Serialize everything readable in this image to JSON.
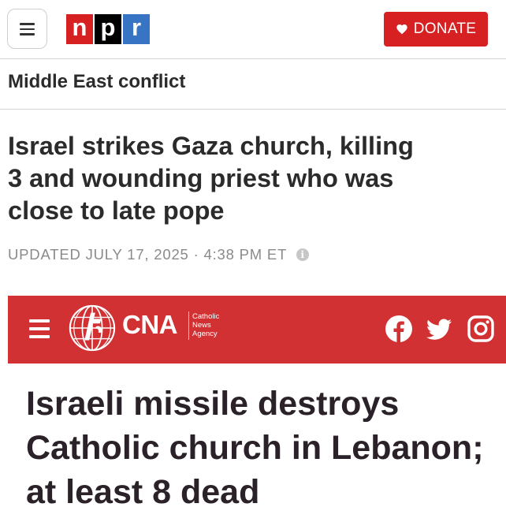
{
  "npr": {
    "logo": {
      "letters": [
        "n",
        "p",
        "r"
      ]
    },
    "donate_label": "DONATE",
    "section": "Middle East conflict",
    "headline_lines": [
      "Israel strikes Gaza church, killing",
      "3 and wounding priest who was",
      "close to late pope"
    ],
    "dateline": "UPDATED JULY 17, 2025 · 4:38 PM ET",
    "info_icon_glyph": "i"
  },
  "cna": {
    "wordmark": "CNA",
    "tagline": [
      "Catholic",
      "News",
      "Agency"
    ],
    "social_icons": [
      "facebook-icon",
      "twitter-icon",
      "instagram-icon"
    ],
    "headline_lines": [
      "Israeli missile destroys",
      "Catholic church in Lebanon;",
      "at least 8 dead"
    ]
  },
  "colors": {
    "npr_red": "#d62021",
    "npr_blue": "#3774c4",
    "cna_red": "#d13133",
    "text_dark": "#2b2b2b",
    "dateline_gray": "#8a8a8a"
  }
}
